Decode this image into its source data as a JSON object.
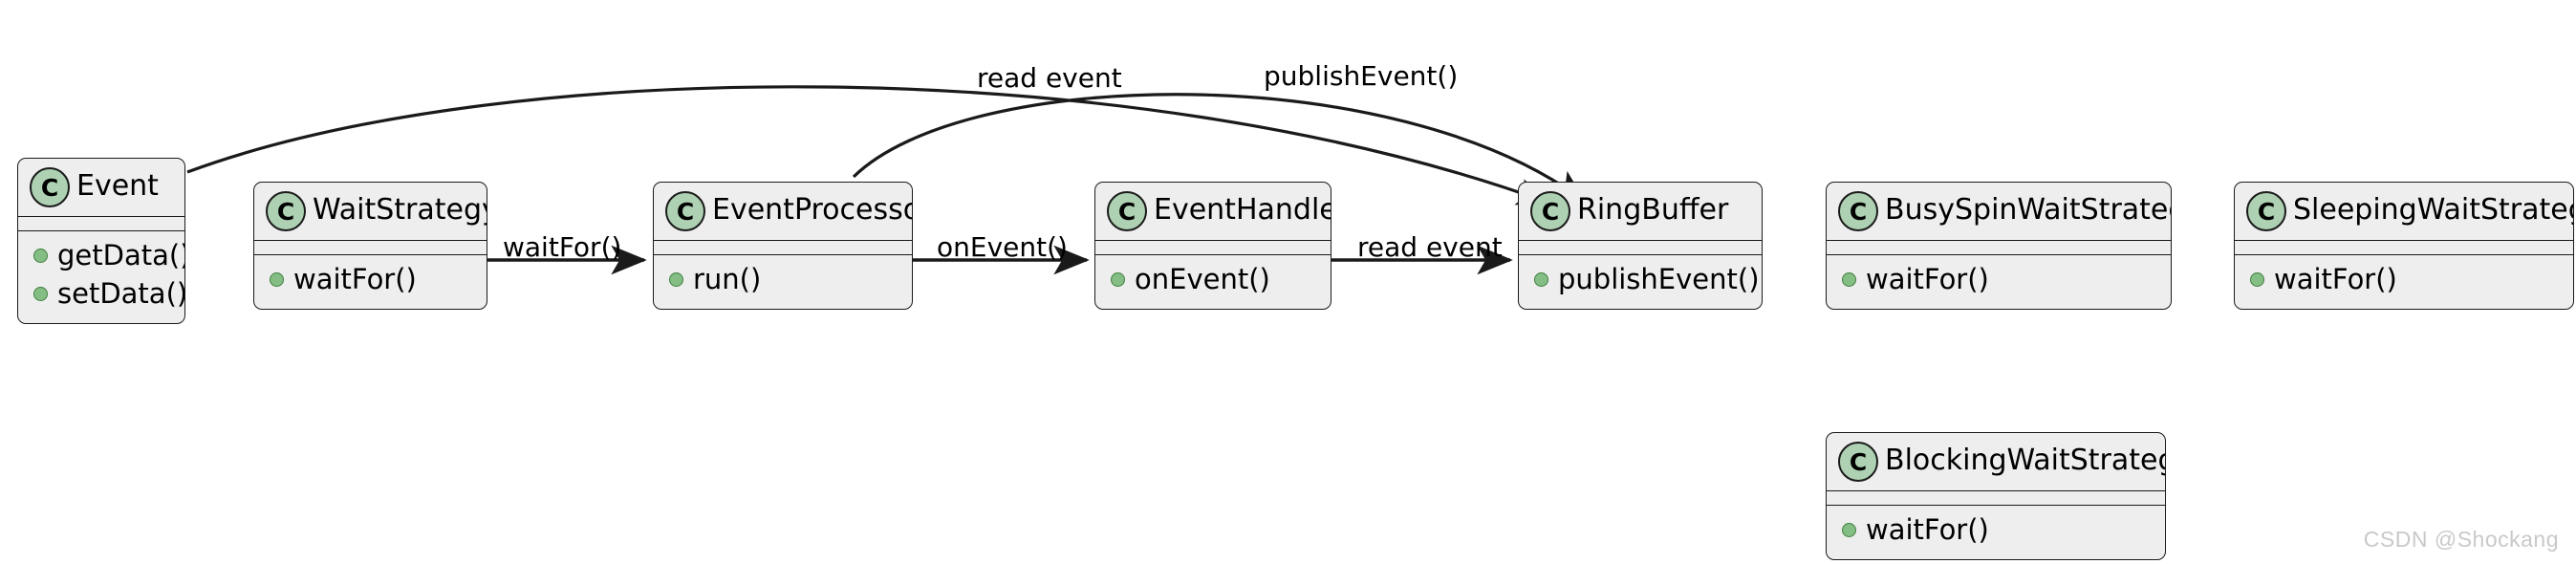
{
  "diagram": {
    "type": "uml-class-diagram",
    "class_icon_letter": "C",
    "colors": {
      "box_fill": "#EEEEEE",
      "box_border": "#1A1A1A",
      "icon_fill": "#ADD1B2",
      "member_dot_fill": "#84BE84",
      "member_dot_border": "#3F7F3F",
      "arrow": "#1A1A1A",
      "background": "#FFFFFF",
      "watermark": "#C9C9C9"
    },
    "classes": [
      {
        "id": "event",
        "name": "Event",
        "members": [
          "getData()",
          "setData()"
        ]
      },
      {
        "id": "wait-strategy",
        "name": "WaitStrategy",
        "members": [
          "waitFor()"
        ]
      },
      {
        "id": "event-processor",
        "name": "EventProcessor",
        "members": [
          "run()"
        ]
      },
      {
        "id": "event-handler",
        "name": "EventHandler",
        "members": [
          "onEvent()"
        ]
      },
      {
        "id": "ring-buffer",
        "name": "RingBuffer",
        "members": [
          "publishEvent()"
        ]
      },
      {
        "id": "busy-spin-wait-strategy",
        "name": "BusySpinWaitStrategy",
        "members": [
          "waitFor()"
        ]
      },
      {
        "id": "sleeping-wait-strategy",
        "name": "SleepingWaitStrategy",
        "members": [
          "waitFor()"
        ]
      },
      {
        "id": "blocking-wait-strategy",
        "name": "BlockingWaitStrategy",
        "members": [
          "waitFor()"
        ]
      }
    ],
    "edges": [
      {
        "id": "wait-strategy-to-event-processor",
        "label": "waitFor()",
        "from": "WaitStrategy",
        "to": "EventProcessor"
      },
      {
        "id": "event-processor-to-event-handler",
        "label": "onEvent()",
        "from": "EventProcessor",
        "to": "EventHandler"
      },
      {
        "id": "event-handler-to-ring-buffer",
        "label": "read event",
        "from": "EventHandler",
        "to": "RingBuffer"
      },
      {
        "id": "event-to-ring-buffer",
        "label": "read event",
        "from": "Event",
        "to": "RingBuffer"
      },
      {
        "id": "event-processor-to-ring-buffer",
        "label": "publishEvent()",
        "from": "EventProcessor",
        "to": "RingBuffer"
      }
    ]
  },
  "watermark": {
    "text": "CSDN @Shockang"
  }
}
